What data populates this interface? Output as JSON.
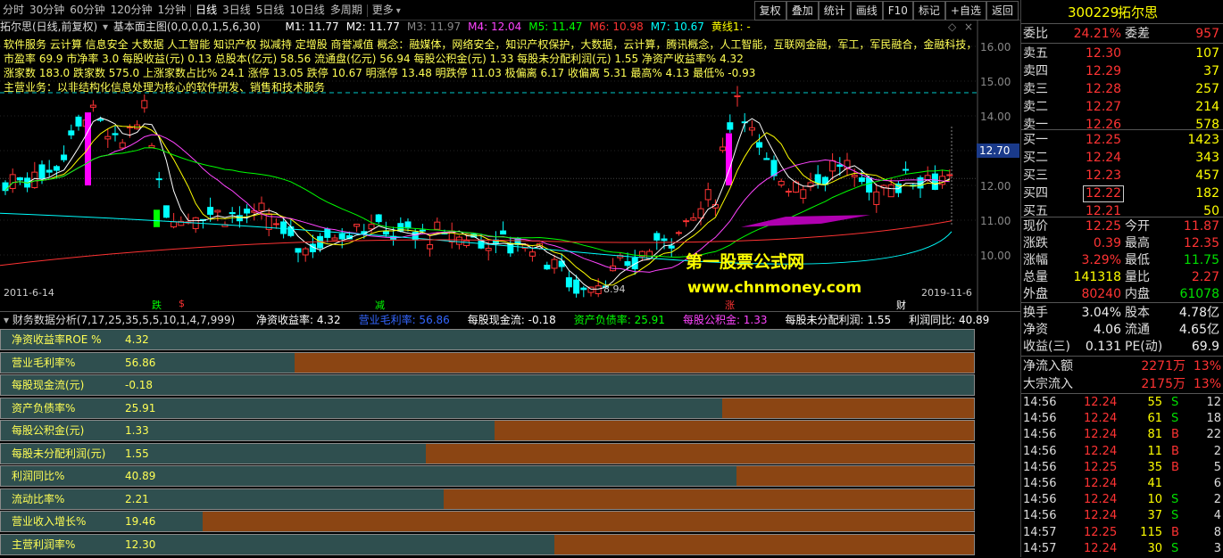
{
  "toolbar": {
    "periods": [
      "分时",
      "30分钟",
      "60分钟",
      "120分钟",
      "1分钟",
      "日线",
      "3日线",
      "5日线",
      "10日线",
      "多周期",
      "更多"
    ],
    "active_period": "日线",
    "right_buttons": [
      "复权",
      "叠加",
      "统计",
      "画线",
      "F10",
      "标记",
      "+自选",
      "返回"
    ]
  },
  "chart": {
    "title": "拓尔思(日线,前复权)",
    "main_indicator": "基本面主图(0,0,0,0,1,5,6,30)",
    "ma": [
      {
        "label": "M1: 11.77",
        "color": "#ffffff"
      },
      {
        "label": "M2: 11.77",
        "color": "#ffffff"
      },
      {
        "label": "M3: 11.97",
        "color": "#888888"
      },
      {
        "label": "M4: 12.04",
        "color": "#ff44ff"
      },
      {
        "label": "M5: 11.47",
        "color": "#00ff00"
      },
      {
        "label": "M6: 10.98",
        "color": "#ff3333"
      },
      {
        "label": "M7: 10.67",
        "color": "#00ffff"
      },
      {
        "label": "黄线1: -",
        "color": "#ffff00"
      }
    ],
    "info_lines": [
      "软件服务 云计算 信息安全 大数据 人工智能 知识产权 拟减持 定增股 商誉减值 概念：融媒体，网络安全，知识产权保护，大数据，云计算，腾讯概念，人工智能，互联网金融，军工，军民融合，金融科技，",
      "市盈率 69.9    市净率 3.0    每股收益(元) 0.13    总股本(亿元) 58.56    流通盘(亿元) 56.94    每股公积金(元) 1.33    每股未分配利润(元) 1.55    净资产收益率% 4.32",
      "涨家数 183.0    跌家数 575.0    上涨家数占比% 24.1    涨停 13.05    跌停 10.67    明涨停 13.48    明跌停 11.03    极偏离 6.17    收偏离 5.31    最高% 4.13    最低% -0.93",
      "主营业务：以非结构化信息处理为核心的软件研发、销售和技术服务"
    ],
    "yticks": [
      "16.00",
      "15.00",
      "14.00",
      "13.00",
      "12.00",
      "11.00",
      "10.00"
    ],
    "current_price_tag": "12.70",
    "low_label": "8.94",
    "date_start": "2011-6-14",
    "date_end": "2019-11-6",
    "markers": [
      {
        "text": "跌",
        "color": "#00ff00"
      },
      {
        "text": "$",
        "color": "#ff3333"
      },
      {
        "text": "减",
        "color": "#00ff00"
      },
      {
        "text": "涨",
        "color": "#ff3333"
      },
      {
        "text": "财",
        "color": "#ffffff"
      }
    ],
    "watermark_title": "第一股票公式网",
    "watermark_url": "www.chnmoney.com"
  },
  "finance_header": {
    "title": "财务数据分析(7,17,25,35,5,5,10,1,4,7,999)",
    "items": [
      {
        "text": "净资收益率: 4.32",
        "color": "#ffffff"
      },
      {
        "text": "营业毛利率: 56.86",
        "color": "#3366ff"
      },
      {
        "text": "每股现金流: -0.18",
        "color": "#ffffff"
      },
      {
        "text": "资产负债率: 25.91",
        "color": "#00ff00"
      },
      {
        "text": "每股公积金: 1.33",
        "color": "#ff44ff"
      },
      {
        "text": "每股未分配利润: 1.55",
        "color": "#ffffff"
      },
      {
        "text": "利润同比: 40.89",
        "color": "#ffffff"
      }
    ]
  },
  "finance_rows": [
    {
      "label": "净资收益率ROE %",
      "value": "4.32",
      "fill": 0.0
    },
    {
      "label": "营业毛利率%",
      "value": "56.86",
      "fill": 0.698
    },
    {
      "label": "每股现金流(元)",
      "value": "-0.18",
      "fill": 0.0
    },
    {
      "label": "资产负债率%",
      "value": "25.91",
      "fill": 0.259
    },
    {
      "label": "每股公积金(元)",
      "value": "1.33",
      "fill": 0.493
    },
    {
      "label": "每股未分配利润(元)",
      "value": "1.55",
      "fill": 0.563
    },
    {
      "label": "利润同比%",
      "value": "40.89",
      "fill": 0.244
    },
    {
      "label": "流动比率%",
      "value": "2.21",
      "fill": 0.545
    },
    {
      "label": "营业收入增长%",
      "value": "19.46",
      "fill": 0.793
    },
    {
      "label": "主营利润率%",
      "value": "12.30",
      "fill": 0.431
    }
  ],
  "quote": {
    "code": "300229",
    "name": "拓尔思",
    "weibi_label": "委比",
    "weibi": "24.21%",
    "weicha_label": "委差",
    "weicha": "957",
    "sells": [
      {
        "label": "卖五",
        "price": "12.30",
        "vol": "107"
      },
      {
        "label": "卖四",
        "price": "12.29",
        "vol": "37"
      },
      {
        "label": "卖三",
        "price": "12.28",
        "vol": "257"
      },
      {
        "label": "卖二",
        "price": "12.27",
        "vol": "214"
      },
      {
        "label": "卖一",
        "price": "12.26",
        "vol": "578"
      }
    ],
    "buys": [
      {
        "label": "买一",
        "price": "12.25",
        "vol": "1423"
      },
      {
        "label": "买二",
        "price": "12.24",
        "vol": "343"
      },
      {
        "label": "买三",
        "price": "12.23",
        "vol": "457"
      },
      {
        "label": "买四",
        "price": "12.22",
        "vol": "182"
      },
      {
        "label": "买五",
        "price": "12.21",
        "vol": "50"
      }
    ],
    "stats": [
      {
        "l1": "现价",
        "v1": "12.25",
        "c1": "#ff3333",
        "l2": "今开",
        "v2": "11.87",
        "c2": "#ff3333"
      },
      {
        "l1": "涨跌",
        "v1": "0.39",
        "c1": "#ff3333",
        "l2": "最高",
        "v2": "12.35",
        "c2": "#ff3333"
      },
      {
        "l1": "涨幅",
        "v1": "3.29%",
        "c1": "#ff3333",
        "l2": "最低",
        "v2": "11.75",
        "c2": "#00e000"
      },
      {
        "l1": "总量",
        "v1": "141318",
        "c1": "#ffff00",
        "l2": "量比",
        "v2": "2.27",
        "c2": "#ff3333"
      },
      {
        "l1": "外盘",
        "v1": "80240",
        "c1": "#ff3333",
        "l2": "内盘",
        "v2": "61078",
        "c2": "#00e000"
      }
    ],
    "stats2": [
      {
        "l1": "换手",
        "v1": "3.04%",
        "l2": "股本",
        "v2": "4.78亿"
      },
      {
        "l1": "净资",
        "v1": "4.06",
        "l2": "流通",
        "v2": "4.65亿"
      },
      {
        "l1": "收益(三)",
        "v1": "0.131",
        "l2": "PE(动)",
        "v2": "69.9"
      }
    ],
    "flows": [
      {
        "label": "净流入额",
        "amount": "2271万",
        "pct": "13%"
      },
      {
        "label": "大宗流入",
        "amount": "2175万",
        "pct": "13%"
      }
    ],
    "ticks": [
      {
        "time": "14:56",
        "price": "12.24",
        "vol": "55",
        "side": "S",
        "n": "12"
      },
      {
        "time": "14:56",
        "price": "12.24",
        "vol": "61",
        "side": "S",
        "n": "18"
      },
      {
        "time": "14:56",
        "price": "12.24",
        "vol": "81",
        "side": "B",
        "n": "22"
      },
      {
        "time": "14:56",
        "price": "12.24",
        "vol": "11",
        "side": "B",
        "n": "2"
      },
      {
        "time": "14:56",
        "price": "12.25",
        "vol": "35",
        "side": "B",
        "n": "5"
      },
      {
        "time": "14:56",
        "price": "12.24",
        "vol": "41",
        "side": "",
        "n": "6"
      },
      {
        "time": "14:56",
        "price": "12.24",
        "vol": "10",
        "side": "S",
        "n": "2"
      },
      {
        "time": "14:56",
        "price": "12.24",
        "vol": "37",
        "side": "S",
        "n": "4"
      },
      {
        "time": "14:57",
        "price": "12.25",
        "vol": "115",
        "side": "B",
        "n": "8"
      },
      {
        "time": "14:57",
        "price": "12.24",
        "vol": "30",
        "side": "S",
        "n": "3"
      }
    ]
  }
}
